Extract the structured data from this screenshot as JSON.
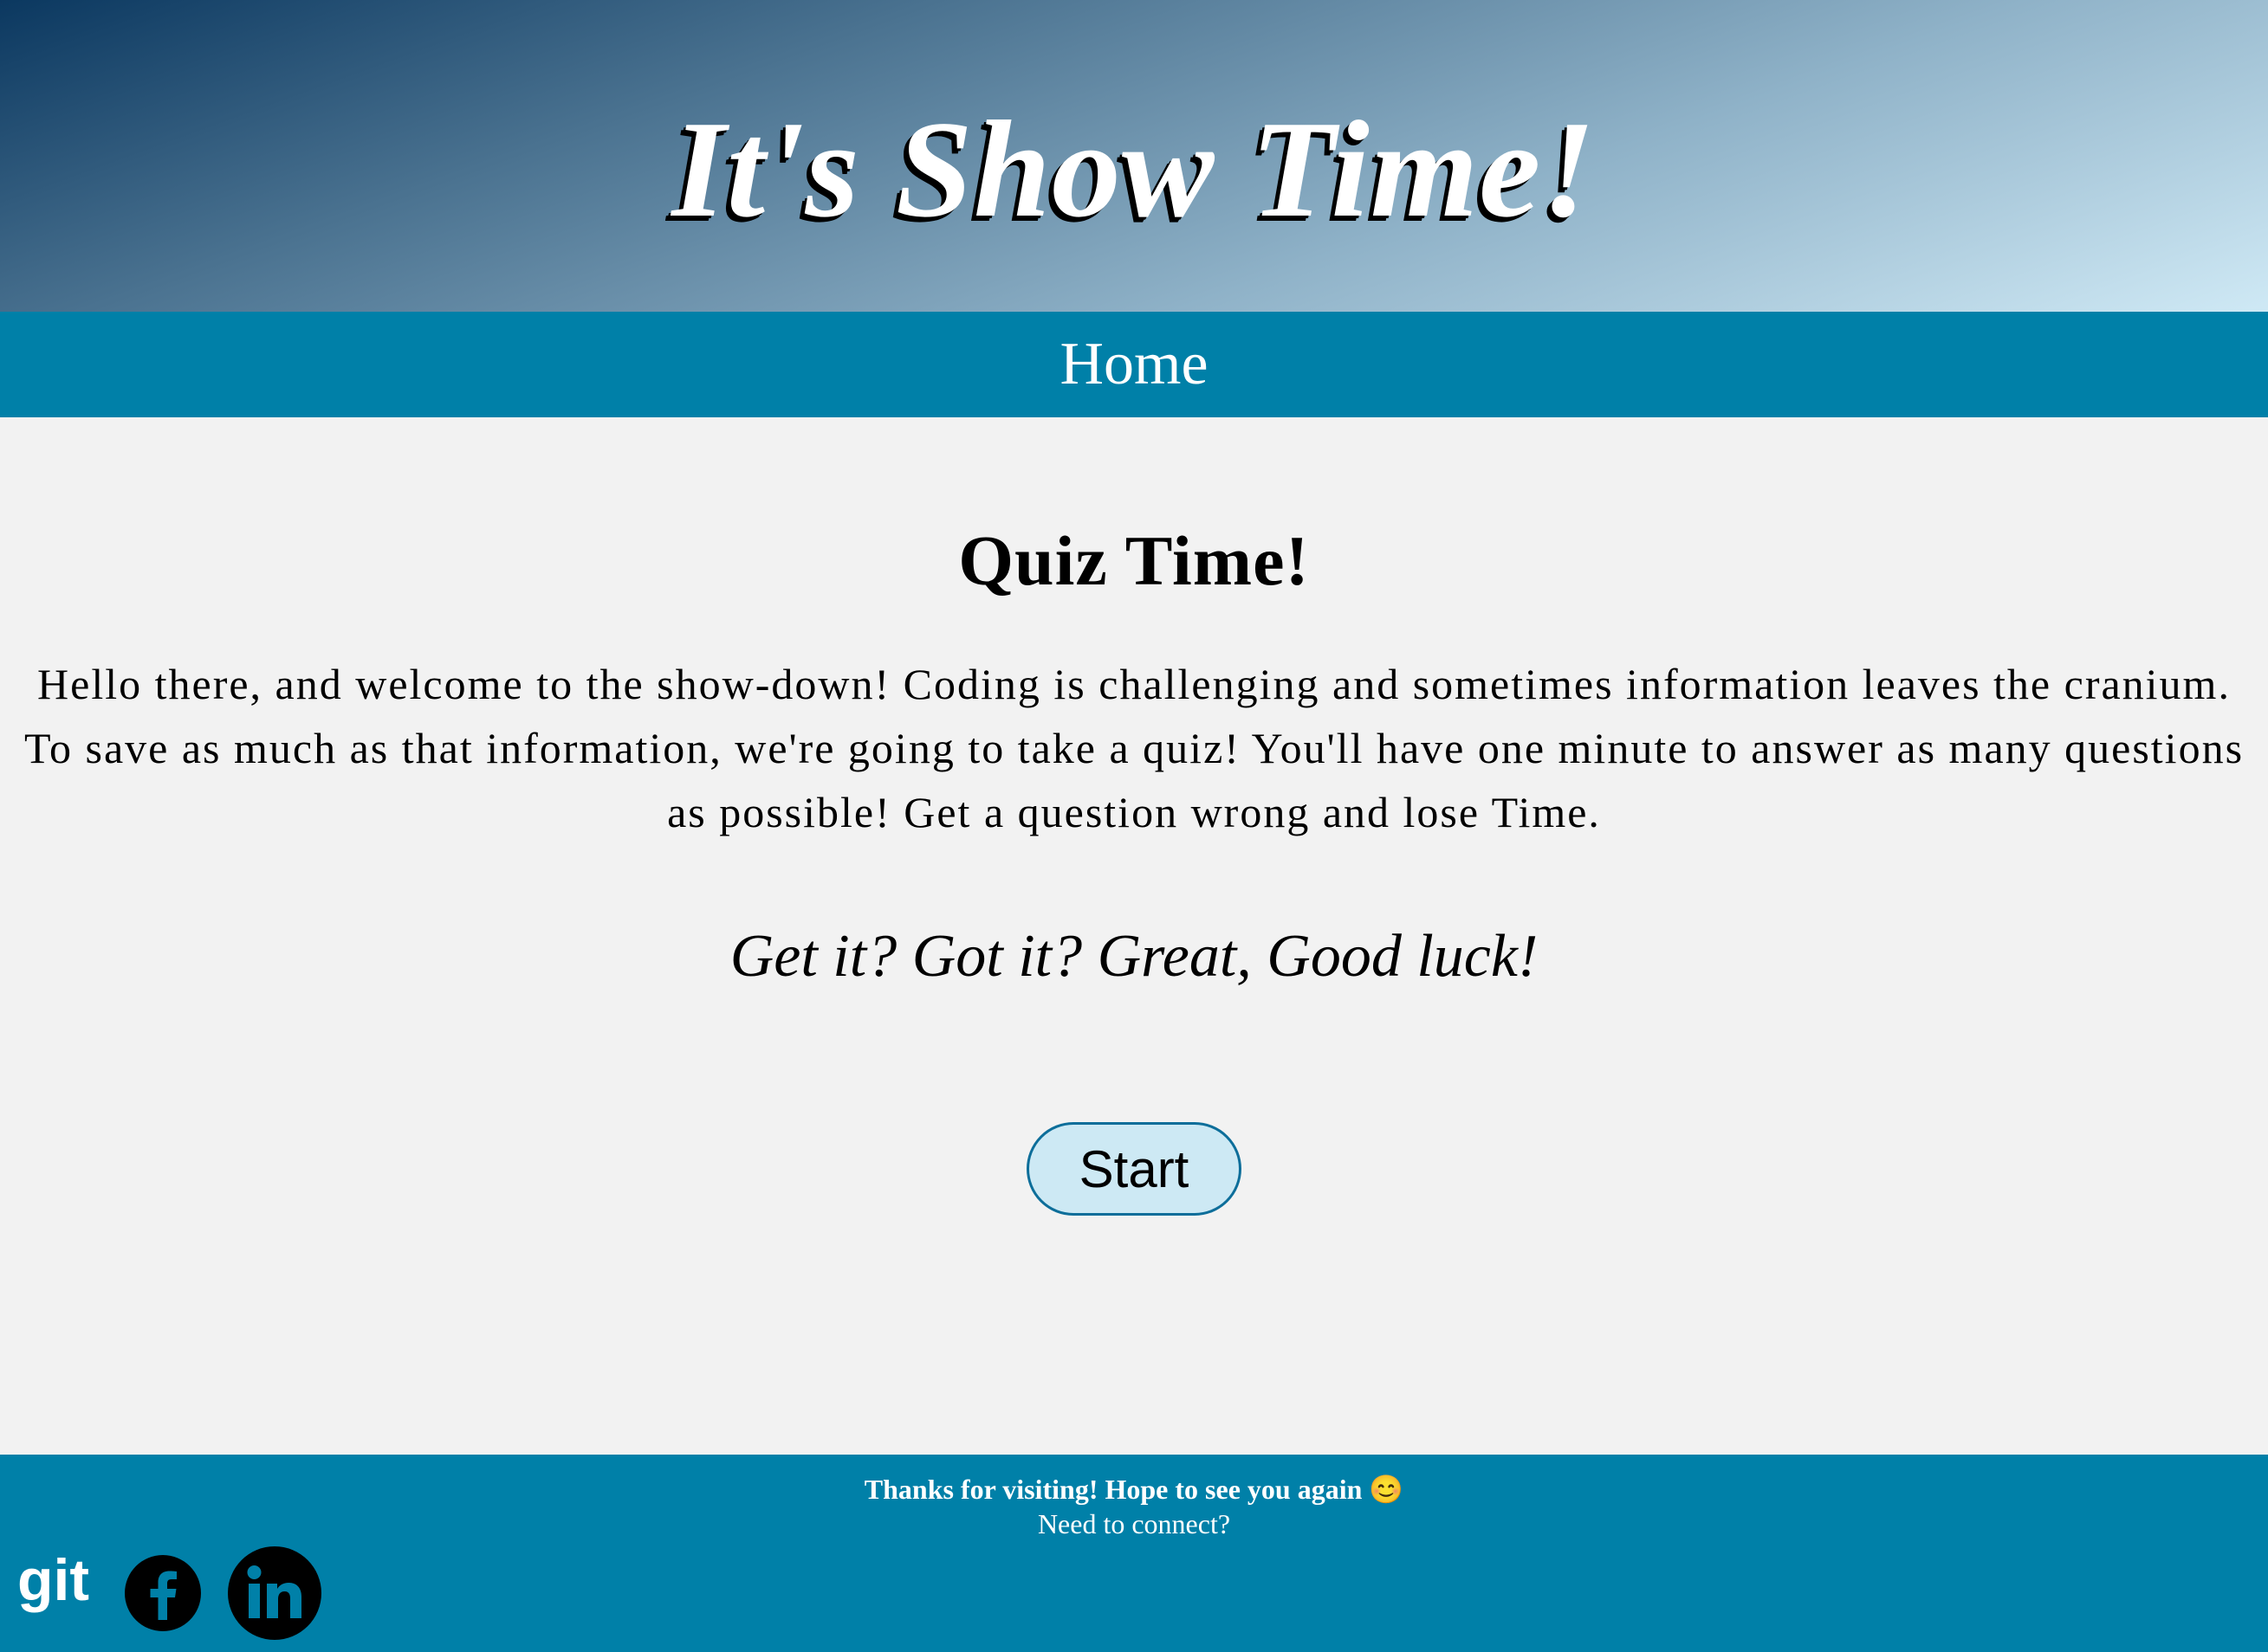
{
  "header": {
    "title": "It's Show Time!"
  },
  "nav": {
    "home_label": "Home"
  },
  "main": {
    "heading": "Quiz Time!",
    "intro": "Hello there, and welcome to the show-down! Coding is challenging and sometimes information leaves the cranium. To save as much as that information, we're going to take a quiz! You'll have one minute to answer as many questions as possible! Get a question wrong and lose Time.",
    "tagline": "Get it? Got it? Great, Good luck!",
    "start_label": "Start"
  },
  "footer": {
    "thanks": "Thanks for visiting! Hope to see you again 😊",
    "connect": "Need to connect?",
    "git_text": "git",
    "social_icons": [
      "git-icon",
      "facebook-icon",
      "linkedin-icon"
    ]
  },
  "colors": {
    "nav_bg": "#0080a8",
    "footer_bg": "#0080a8",
    "page_bg": "#f2f2f2",
    "button_bg": "#cde9f4",
    "button_border": "#0d6e9a"
  }
}
